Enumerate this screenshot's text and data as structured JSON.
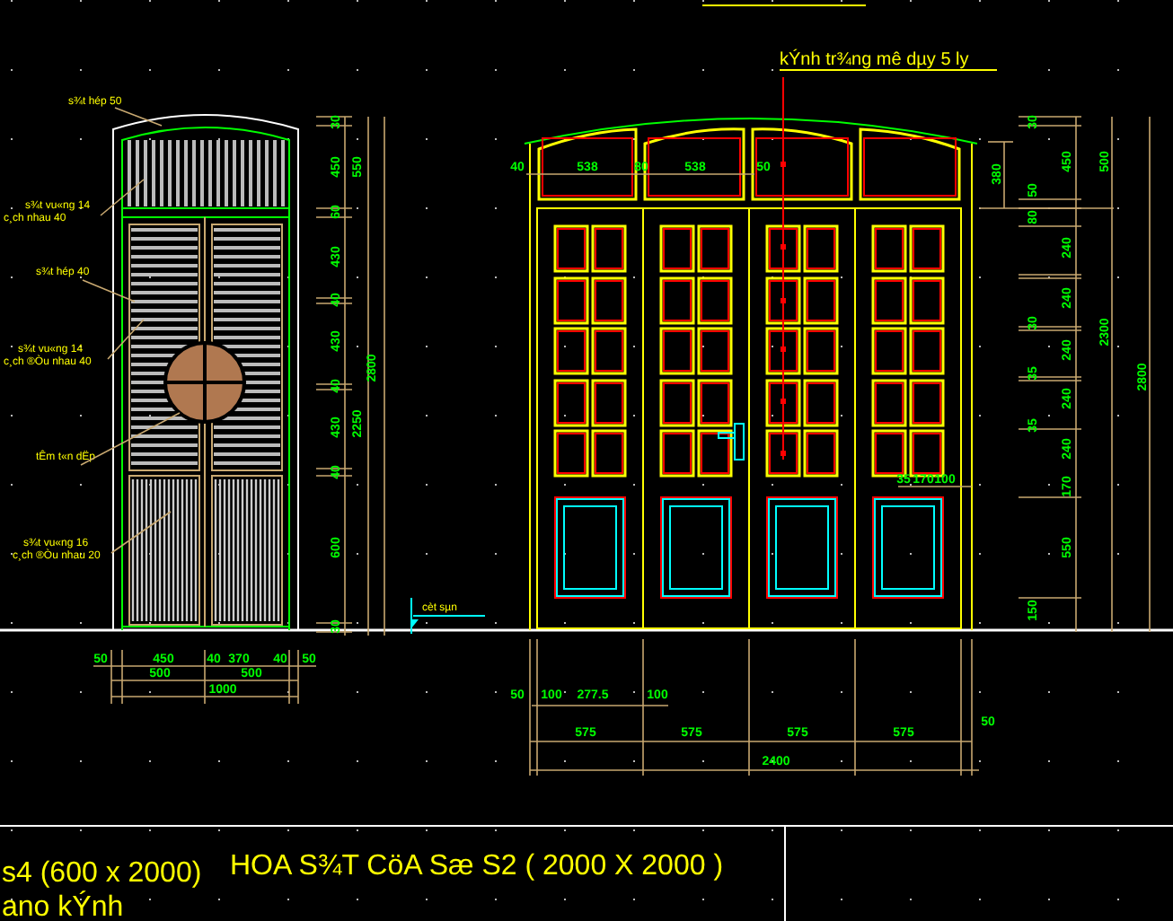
{
  "callout": "kÝnh tr¾ng mê dµy 5 ly",
  "left_elevation": {
    "annotations": [
      "s¾t hép 50",
      "s¾t vu«ng 14",
      "c¸ch nhau 40",
      "s¾t hép 40",
      "s¾t vu«ng 14",
      "c¸ch ®Òu nhau 40",
      "tÊm t«n dËp",
      "s¾t vu«ng 16",
      "c¸ch ®Òu nhau 20"
    ],
    "level_mark": "cèt sµn",
    "vertical_dims": [
      "30",
      "450",
      "60",
      "430",
      "40",
      "430",
      "40",
      "430",
      "40",
      "600",
      "30",
      "550",
      "2250",
      "2800"
    ],
    "horizontal_dims": [
      "50",
      "450",
      "40",
      "370",
      "40",
      "50",
      "500",
      "500",
      "1000"
    ]
  },
  "right_elevation": {
    "top_dims": [
      "40",
      "538",
      "80",
      "538",
      "50"
    ],
    "vertical_dims": [
      "380",
      "30",
      "50",
      "80",
      "30",
      "35",
      "35",
      "150",
      "450",
      "240",
      "240",
      "240",
      "240",
      "240",
      "170",
      "550",
      "500",
      "2300",
      "2800"
    ],
    "mid_dims": [
      "35",
      "170",
      "100"
    ],
    "bottom_dims": [
      "50",
      "100",
      "277.5",
      "100",
      "575",
      "575",
      "575",
      "575",
      "50",
      "2400"
    ]
  },
  "title_block": {
    "texts": [
      "s4 (600 x 2000)",
      "HOA S¾T CöA Sæ S2 ( 2000 X 2000 )",
      "ano  kÝnh"
    ]
  }
}
